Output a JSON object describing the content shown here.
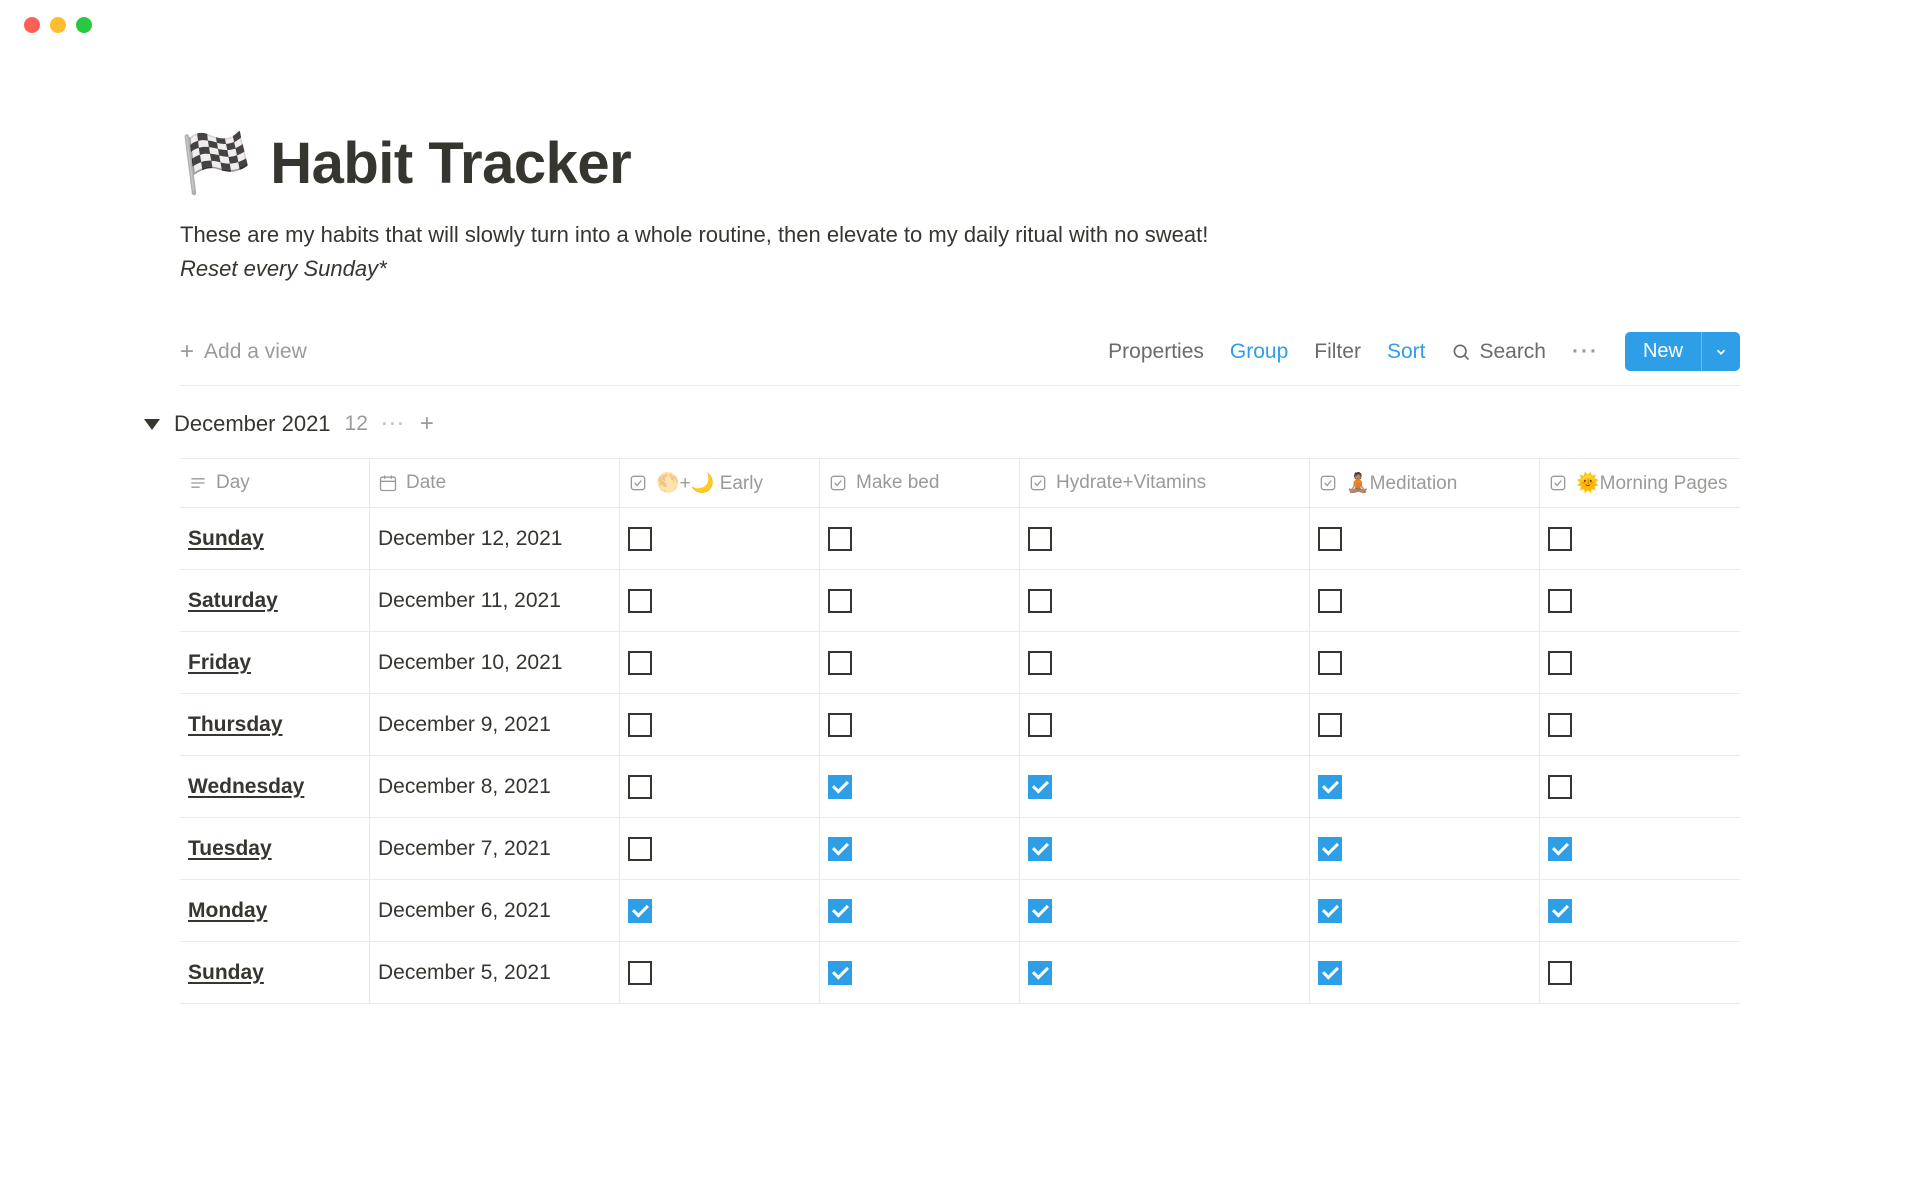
{
  "page": {
    "emoji": "🏁",
    "title": "Habit Tracker",
    "description": "These are my habits that will slowly turn into a whole routine, then elevate to my daily ritual with no sweat!",
    "note": "Reset every Sunday*"
  },
  "toolbar": {
    "add_view": "Add a view",
    "properties": "Properties",
    "group": "Group",
    "filter": "Filter",
    "sort": "Sort",
    "search": "Search",
    "new": "New"
  },
  "group": {
    "title": "December 2021",
    "count": "12"
  },
  "columns": [
    {
      "icon": "text",
      "label": "Day"
    },
    {
      "icon": "date",
      "label": "Date"
    },
    {
      "icon": "check",
      "label": "🌕+🌙 Early"
    },
    {
      "icon": "check",
      "label": "Make bed"
    },
    {
      "icon": "check",
      "label": "Hydrate+Vitamins"
    },
    {
      "icon": "check",
      "label": "🧘🏽Meditation"
    },
    {
      "icon": "check",
      "label": "🌞Morning Pages"
    }
  ],
  "rows": [
    {
      "day": "Sunday",
      "date": "December 12, 2021",
      "c": [
        false,
        false,
        false,
        false,
        false
      ]
    },
    {
      "day": "Saturday",
      "date": "December 11, 2021",
      "c": [
        false,
        false,
        false,
        false,
        false
      ]
    },
    {
      "day": "Friday",
      "date": "December 10, 2021",
      "c": [
        false,
        false,
        false,
        false,
        false
      ]
    },
    {
      "day": "Thursday",
      "date": "December 9, 2021",
      "c": [
        false,
        false,
        false,
        false,
        false
      ]
    },
    {
      "day": "Wednesday",
      "date": "December 8, 2021",
      "c": [
        false,
        true,
        true,
        true,
        false
      ]
    },
    {
      "day": "Tuesday",
      "date": "December 7, 2021",
      "c": [
        false,
        true,
        true,
        true,
        true
      ]
    },
    {
      "day": "Monday",
      "date": "December 6, 2021",
      "c": [
        true,
        true,
        true,
        true,
        true
      ]
    },
    {
      "day": "Sunday",
      "date": "December 5, 2021",
      "c": [
        false,
        true,
        true,
        true,
        false
      ]
    }
  ]
}
